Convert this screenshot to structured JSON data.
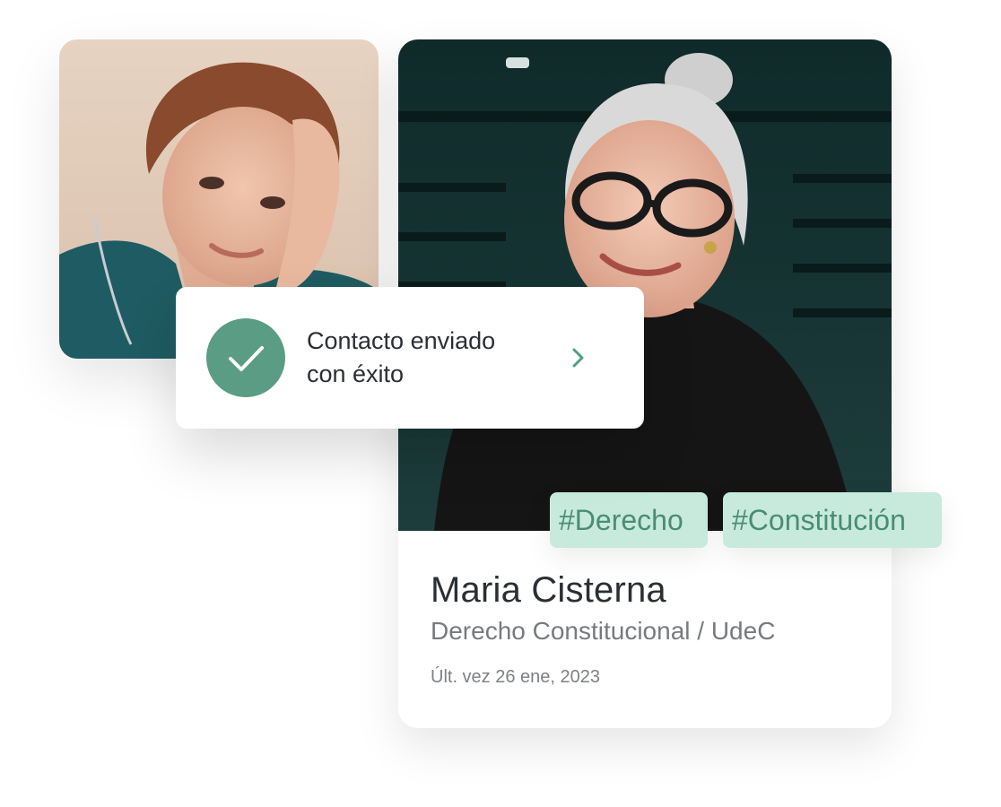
{
  "toast": {
    "line1": "Contacto enviado",
    "line2": "con éxito",
    "check_icon": "check-icon",
    "chevron_icon": "chevron-right-icon"
  },
  "profile": {
    "name": "Maria Cisterna",
    "role": "Derecho Constitucional / UdeC",
    "last_seen": "Últ. vez 26 ene, 2023",
    "tags": [
      "#Derecho",
      "#Constitución"
    ]
  },
  "colors": {
    "accent": "#5a9c84",
    "tag_bg": "#c7eadc",
    "tag_text": "#4a8d74",
    "name_text": "#2b2f33",
    "muted_text": "#777b7e"
  }
}
